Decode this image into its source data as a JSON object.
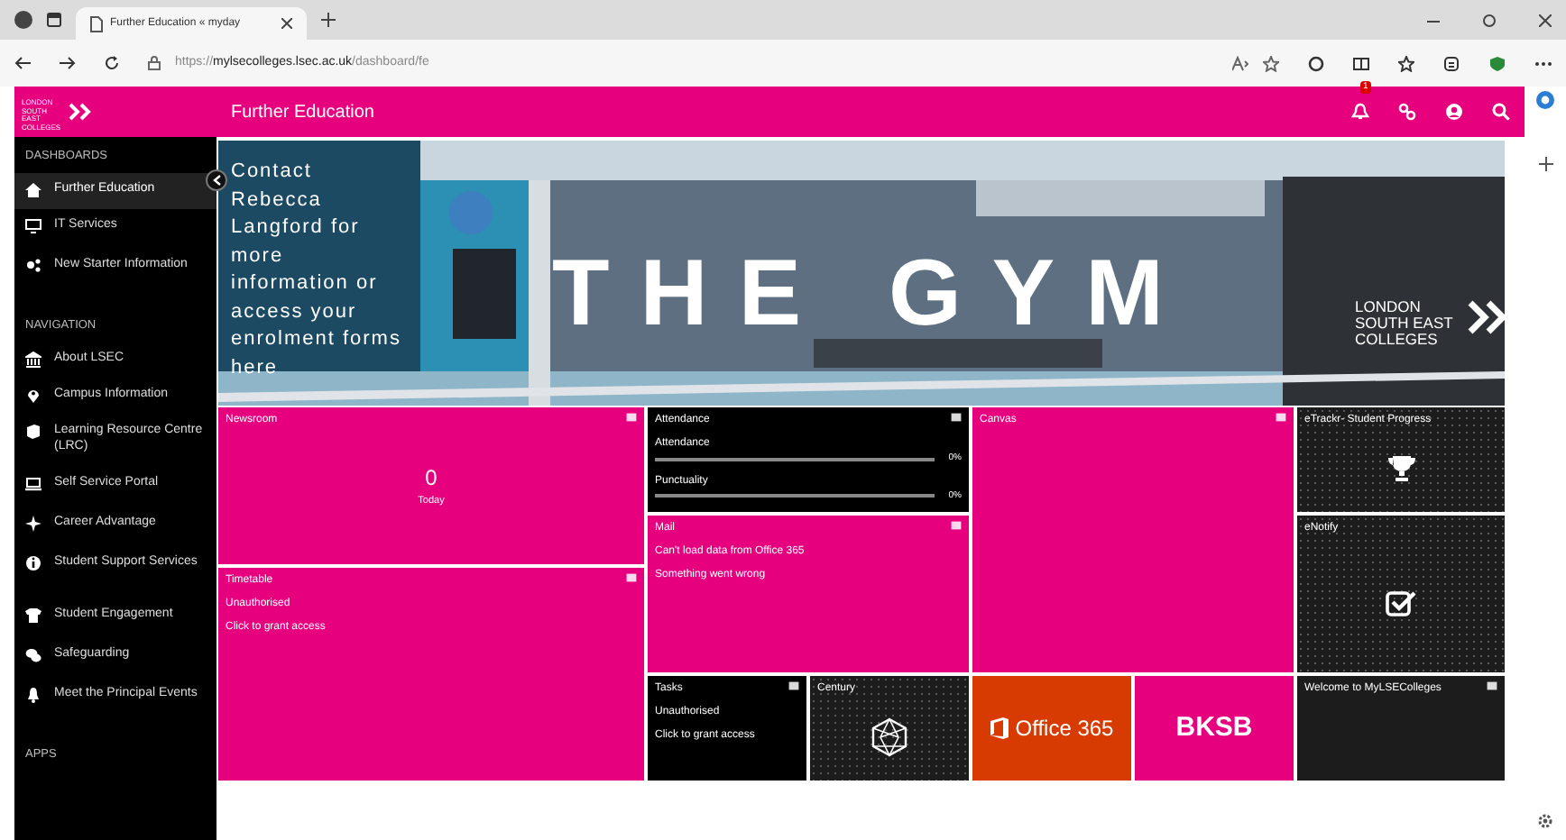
{
  "browser": {
    "tab_title": "Further Education « myday",
    "url": "https://**mylsecolleges.lsec.ac.uk**/dashboard/fe"
  },
  "header": {
    "logo": "LONDON SOUTH EAST COLLEGES",
    "title": "Further Education",
    "notification_count": "1"
  },
  "sidebar": {
    "sections": [
      {
        "heading": "DASHBOARDS",
        "items": [
          {
            "label": "Further Education",
            "selected": true
          },
          {
            "label": "IT Services",
            "selected": false
          },
          {
            "label": "New Starter Information",
            "selected": false
          }
        ]
      },
      {
        "heading": "NAVIGATION",
        "items": [
          {
            "label": "About LSEC",
            "selected": false
          },
          {
            "label": "Campus Information",
            "selected": false
          },
          {
            "label": "Learning Resource Centre (LRC)",
            "selected": false
          },
          {
            "label": "Self Service Portal",
            "selected": false
          },
          {
            "label": "Career Advantage",
            "selected": false
          },
          {
            "label": "Student Support Services",
            "selected": false
          },
          {
            "label": "Student Engagement",
            "selected": false
          },
          {
            "label": "Safeguarding",
            "selected": false
          },
          {
            "label": "Meet the Principal Events",
            "selected": false
          }
        ]
      },
      {
        "heading": "APPS"
      }
    ]
  },
  "banner": {
    "kind": "picture",
    "caption": "Contact Rebecca Langford for more information or access your enrolment forms here",
    "headline": "THE GYM",
    "logo": "LONDON SOUTH EAST COLLEGES"
  },
  "tiles": [
    {
      "kind": "count",
      "title": "Newsroom",
      "color": "#e6007e",
      "count": "0",
      "caption": "Today"
    },
    {
      "kind": "meters",
      "title": "Attendance",
      "color": "#000000",
      "meters": [
        {
          "label": "Attendance",
          "level": 0,
          "reading": "0%"
        },
        {
          "label": "Punctuality",
          "level": 0,
          "reading": "0%"
        }
      ]
    },
    {
      "kind": "plain",
      "title": "Canvas",
      "color": "#e6007e"
    },
    {
      "kind": "emblem",
      "title": "eTrackr- Student Progress",
      "color": "#1c1c1c"
    },
    {
      "kind": "message",
      "title": "Mail",
      "color": "#e6007e",
      "lines": [
        "Can't load data from Office 365",
        "Something went wrong"
      ]
    },
    {
      "kind": "emblem",
      "title": "eNotify",
      "color": "#1c1c1c"
    },
    {
      "kind": "message",
      "title": "Timetable",
      "color": "#e6007e",
      "lines": [
        "Unauthorised",
        "Click to grant access"
      ]
    },
    {
      "kind": "message",
      "title": "Tasks",
      "color": "#000000",
      "lines": [
        "Unauthorised",
        "Click to grant access"
      ]
    },
    {
      "kind": "emblem",
      "title": "Century",
      "color": "#1c1c1c"
    },
    {
      "kind": "brand",
      "label": "Office 365",
      "color": "#d83b01"
    },
    {
      "kind": "brand",
      "label": "BKSB",
      "color": "#e6007e"
    },
    {
      "kind": "plain",
      "title": "Welcome to MyLSEColleges",
      "color": "#1c1c1c"
    }
  ]
}
